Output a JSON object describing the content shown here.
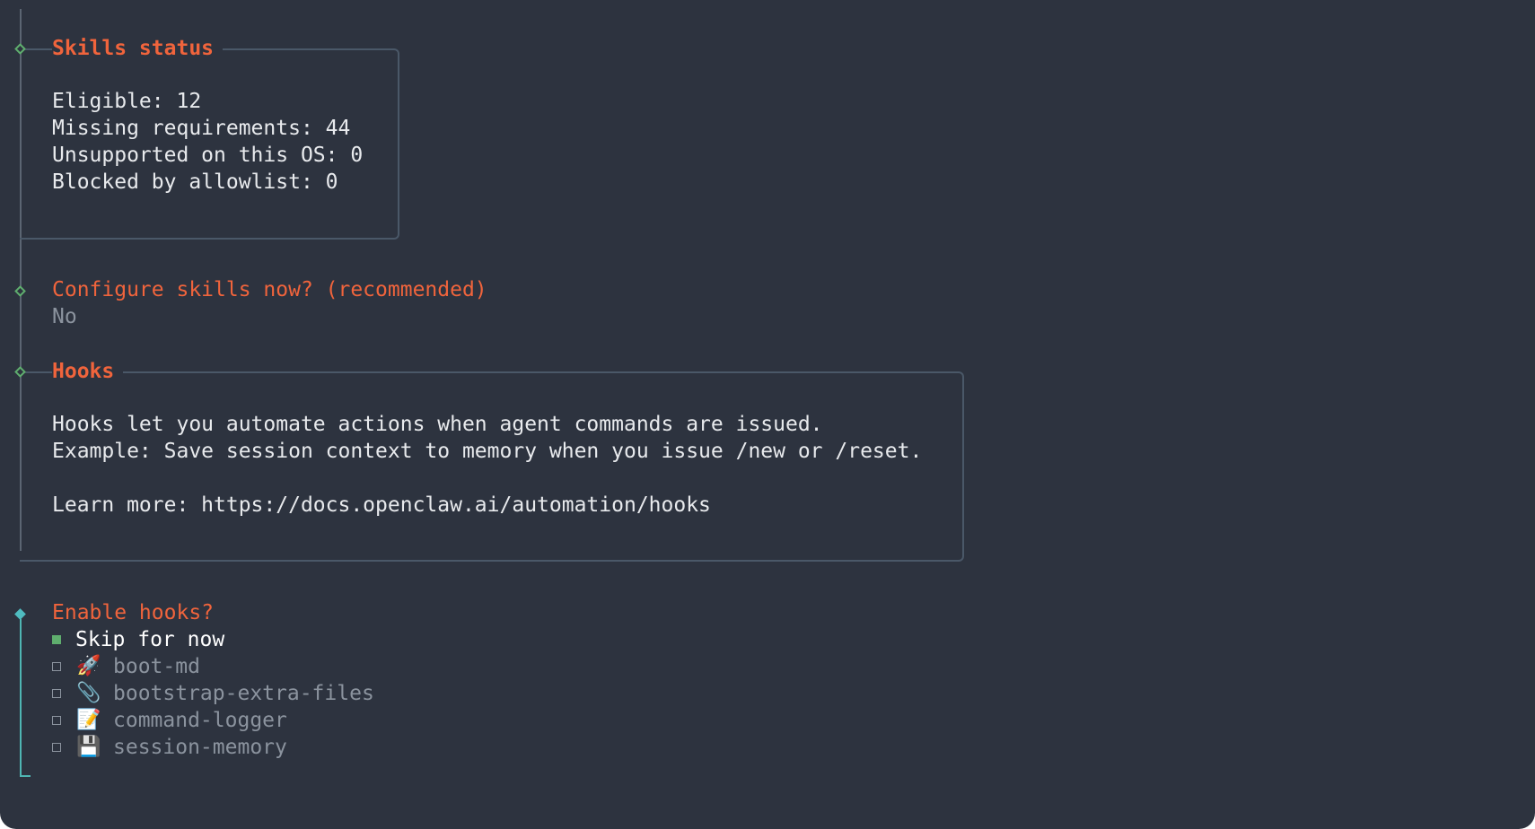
{
  "skills_status": {
    "title": "Skills status",
    "lines": [
      "Eligible: 12",
      "Missing requirements: 44",
      "Unsupported on this OS: 0",
      "Blocked by allowlist: 0"
    ]
  },
  "configure_skills": {
    "question": "Configure skills now? (recommended)",
    "answer": "No"
  },
  "hooks_info": {
    "title": "Hooks",
    "line1": "Hooks let you automate actions when agent commands are issued.",
    "line2": "Example: Save session context to memory when you issue /new or /reset.",
    "learn_more": "Learn more: https://docs.openclaw.ai/automation/hooks"
  },
  "enable_hooks": {
    "question": "Enable hooks?",
    "options": [
      {
        "label": "Skip for now",
        "icon": "",
        "checked": true
      },
      {
        "label": "boot-md",
        "icon": "🚀",
        "icon_name": "rocket-icon",
        "checked": false
      },
      {
        "label": "bootstrap-extra-files",
        "icon": "📎",
        "icon_name": "paperclip-icon",
        "checked": false
      },
      {
        "label": "command-logger",
        "icon": "📝",
        "icon_name": "memo-icon",
        "checked": false
      },
      {
        "label": "session-memory",
        "icon": "💾",
        "icon_name": "floppy-disk-icon",
        "checked": false
      }
    ]
  },
  "colors": {
    "background": "#2d333f",
    "heading": "#f0643c",
    "text": "#e8eaed",
    "dim": "#8b939e",
    "diamond": "#5fae6e",
    "active_line": "#4fb6b3",
    "box_border": "#4a5868"
  }
}
